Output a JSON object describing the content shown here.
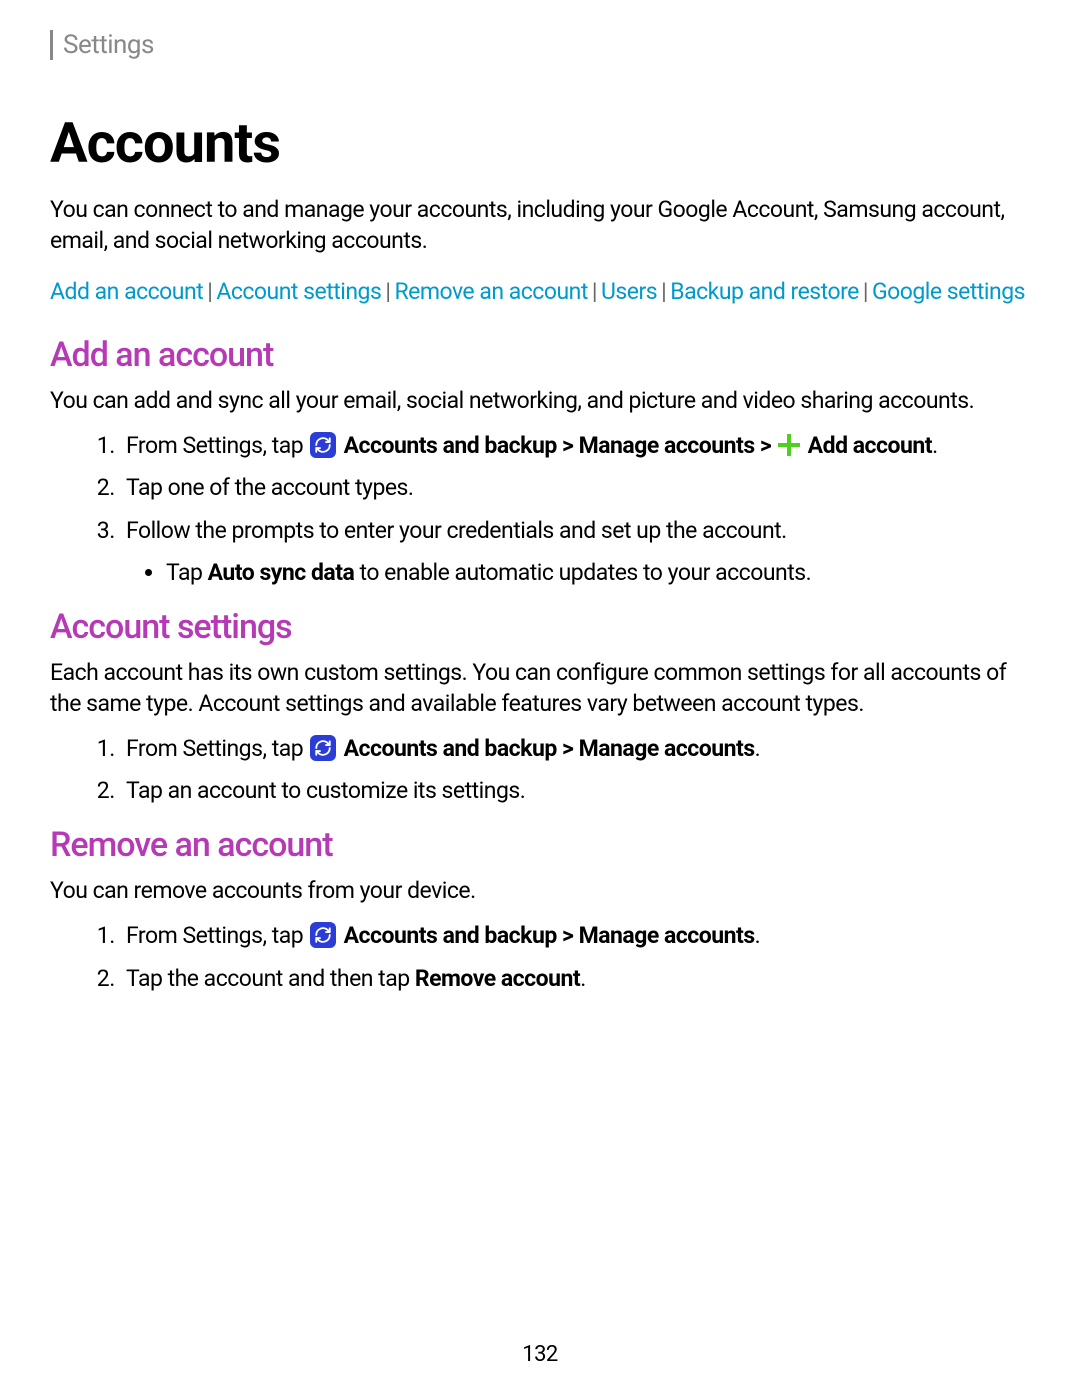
{
  "breadcrumb": "Settings",
  "title": "Accounts",
  "intro": "You can connect to and manage your accounts, including your Google Account, Samsung account, email, and social networking accounts.",
  "toc": {
    "add_account": "Add an account",
    "account_settings": "Account settings",
    "remove_account": "Remove an account",
    "users": "Users",
    "backup_restore": "Backup and restore",
    "google_settings": "Google settings"
  },
  "sections": {
    "add": {
      "title": "Add an account",
      "desc": "You can add and sync all your email, social networking, and picture and video sharing accounts.",
      "step1_prefix": "From Settings, tap ",
      "step1_accounts_backup": " Accounts and backup",
      "step1_sep": " > ",
      "step1_manage": "Manage accounts",
      "step1_sep2": " > ",
      "step1_add_account_label": " Add account",
      "step1_period": ".",
      "step2": "Tap one of the account types.",
      "step3": "Follow the prompts to enter your credentials and set up the account.",
      "step3_sub_prefix": "Tap ",
      "step3_sub_bold": "Auto sync data",
      "step3_sub_suffix": " to enable automatic updates to your accounts."
    },
    "settings": {
      "title": "Account settings",
      "desc": "Each account has its own custom settings. You can configure common settings for all accounts of the same type. Account settings and available features vary between account types.",
      "step1_prefix": "From Settings, tap ",
      "step1_accounts_backup": " Accounts and backup",
      "step1_sep": " > ",
      "step1_manage": "Manage accounts",
      "step1_period": ".",
      "step2": "Tap an account to customize its settings."
    },
    "remove": {
      "title": "Remove an account",
      "desc": "You can remove accounts from your device.",
      "step1_prefix": "From Settings, tap ",
      "step1_accounts_backup": " Accounts and backup",
      "step1_sep": " > ",
      "step1_manage": "Manage accounts",
      "step1_period": ".",
      "step2_prefix": "Tap the account and then tap ",
      "step2_bold": "Remove account",
      "step2_period": "."
    }
  },
  "page_number": "132"
}
